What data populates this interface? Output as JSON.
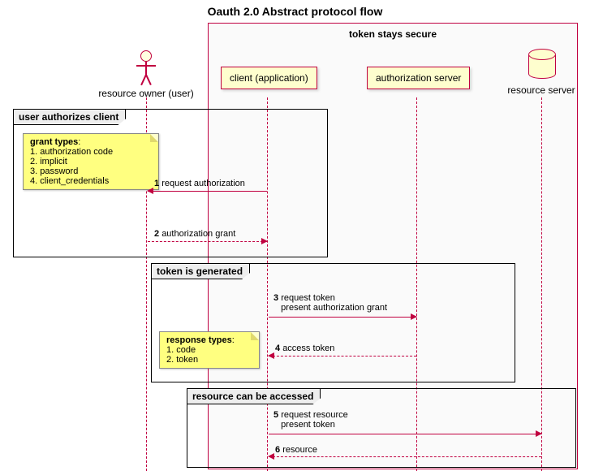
{
  "title": "Oauth 2.0 Abstract protocol flow",
  "outer_box_title": "token stays secure",
  "participants": {
    "user": "resource owner (user)",
    "client": "client (application)",
    "authz": "authorization server",
    "resource": "resource server"
  },
  "groups": {
    "g1": "user authorizes client",
    "g2": "token is generated",
    "g3": "resource can be accessed"
  },
  "notes": {
    "grant": {
      "title": "grant types",
      "items": [
        "1. authorization code",
        "2. implicit",
        "3. password",
        "4. client_credentials"
      ]
    },
    "response": {
      "title": "response types",
      "items": [
        "1. code",
        "2. token"
      ]
    }
  },
  "messages": {
    "m1": {
      "num": "1",
      "text": "request authorization"
    },
    "m2": {
      "num": "2",
      "text": "authorization grant"
    },
    "m3": {
      "num": "3",
      "text": "request token",
      "text2": "present authorization grant"
    },
    "m4": {
      "num": "4",
      "text": "access token"
    },
    "m5": {
      "num": "5",
      "text": "request resource",
      "text2": "present token"
    },
    "m6": {
      "num": "6",
      "text": "resource"
    }
  }
}
